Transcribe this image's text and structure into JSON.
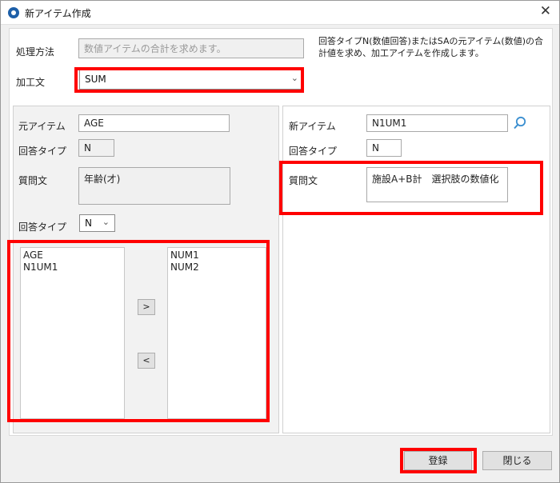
{
  "window": {
    "title": "新アイテム作成"
  },
  "top": {
    "method_label": "処理方法",
    "method_placeholder": "数値アイテムの合計を求めます。",
    "description": "回答タイプN(数値回答)またはSAの元アイテム(数値)の合計値を求め、加工アイテムを作成します。",
    "formula_label": "加工文",
    "formula_value": "SUM"
  },
  "left": {
    "source_item_label": "元アイテム",
    "source_item_value": "AGE",
    "answer_type_label": "回答タイプ",
    "answer_type_value": "N",
    "question_label": "質問文",
    "question_value": "年齢(才)",
    "answer_type_select_label": "回答タイプ",
    "answer_type_select_value": "N",
    "available_items": [
      "AGE",
      "N1UM1"
    ],
    "selected_items": [
      "NUM1",
      "NUM2"
    ],
    "add_button": ">",
    "remove_button": "<"
  },
  "right": {
    "new_item_label": "新アイテム",
    "new_item_value": "N1UM1",
    "answer_type_label": "回答タイプ",
    "answer_type_value": "N",
    "question_label": "質問文",
    "question_value": "施設A+B計　選択肢の数値化"
  },
  "footer": {
    "register_label": "登録",
    "close_label": "閉じる"
  },
  "colors": {
    "highlight": "#ff0000",
    "accent": "#1d5fa8"
  }
}
